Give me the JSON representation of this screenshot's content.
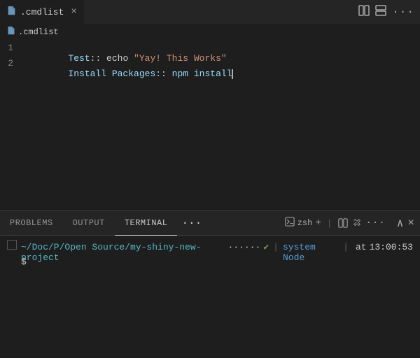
{
  "tabbar": {
    "tab_icon": "📄",
    "tab_label": ".cmdlist",
    "tab_close": "×",
    "action_split_editor": "⧉",
    "action_split_layout": "⊞",
    "action_more": "···"
  },
  "breadcrumb": {
    "icon": "📄",
    "label": ".cmdlist"
  },
  "editor": {
    "lines": [
      {
        "number": "1",
        "parts": [
          {
            "text": "Test",
            "class": "kw"
          },
          {
            "text": ":: echo ",
            "class": "op"
          },
          {
            "text": "\"Yay! This Works\"",
            "class": "string"
          }
        ]
      },
      {
        "number": "2",
        "parts": [
          {
            "text": "Install Packages",
            "class": "kw"
          },
          {
            "text": ":: ",
            "class": "op"
          },
          {
            "text": "npm install",
            "class": "pkg"
          }
        ],
        "cursor": true
      }
    ]
  },
  "panel": {
    "tabs": [
      {
        "label": "PROBLEMS",
        "active": false
      },
      {
        "label": "OUTPUT",
        "active": false
      },
      {
        "label": "TERMINAL",
        "active": true
      }
    ],
    "tab_extra_dots": "···",
    "actions": {
      "shell_icon": "+",
      "shell_label": "zsh",
      "split": "⊞",
      "trash": "🗑",
      "more_dots": "···",
      "chevron_up": "∧",
      "close": "×"
    },
    "terminal": {
      "path": "~/Doc/P/Open Source/my-shiny-new-project",
      "dots": "······",
      "check": "✔",
      "separator": "|",
      "node_label": "system Node",
      "at": "at",
      "time": "13:00:53",
      "prompt": "$"
    }
  }
}
